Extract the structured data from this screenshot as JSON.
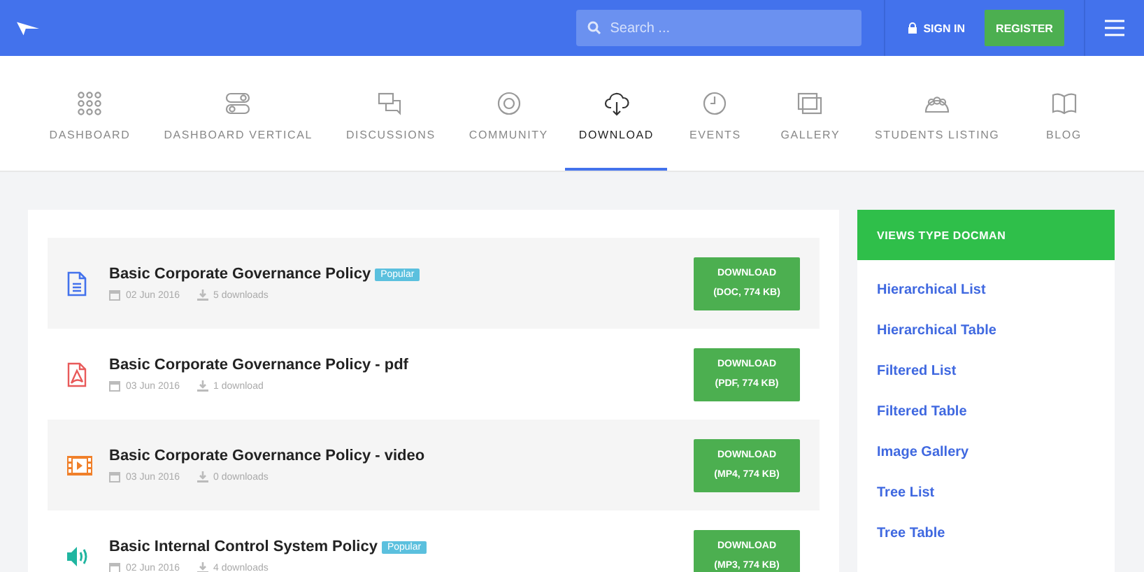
{
  "header": {
    "search": {
      "placeholder": "Search ..."
    },
    "sign_in": "SIGN IN",
    "register": "REGISTER"
  },
  "nav": [
    {
      "label": "DASHBOARD",
      "kind": "grid",
      "selected": false
    },
    {
      "label": "DASHBOARD VERTICAL",
      "kind": "toggles",
      "selected": false
    },
    {
      "label": "DISCUSSIONS",
      "kind": "chat",
      "selected": false
    },
    {
      "label": "COMMUNITY",
      "kind": "target",
      "selected": false
    },
    {
      "label": "DOWNLOAD",
      "kind": "cloud",
      "selected": true
    },
    {
      "label": "EVENTS",
      "kind": "clock",
      "selected": false
    },
    {
      "label": "GALLERY",
      "kind": "gallery",
      "selected": false
    },
    {
      "label": "STUDENTS LISTING",
      "kind": "people",
      "selected": false
    },
    {
      "label": "BLOG",
      "kind": "book",
      "selected": false
    }
  ],
  "documents": [
    {
      "title": "Basic Corporate Governance Policy",
      "kind": "doc",
      "badge": "Popular",
      "date": "02 Jun 2016",
      "downloads": "5 downloads",
      "button": "DOWNLOAD",
      "file": "(DOC, 774 KB)"
    },
    {
      "title": "Basic Corporate Governance Policy - pdf",
      "kind": "pdf",
      "date": "03 Jun 2016",
      "downloads": "1 download",
      "button": "DOWNLOAD",
      "file": "(PDF, 774 KB)"
    },
    {
      "title": "Basic Corporate Governance Policy - video",
      "kind": "video",
      "date": "03 Jun 2016",
      "downloads": "0 downloads",
      "button": "DOWNLOAD",
      "file": "(MP4, 774 KB)"
    },
    {
      "title": "Basic Internal Control System Policy",
      "kind": "audio",
      "badge": "Popular",
      "date": "02 Jun 2016",
      "downloads": "4 downloads",
      "button": "DOWNLOAD",
      "file": "(MP3, 774 KB)"
    }
  ],
  "sidebar": {
    "title": "VIEWS TYPE DOCMAN",
    "links": [
      "Hierarchical List",
      "Hierarchical Table",
      "Filtered List",
      "Filtered Table",
      "Image Gallery",
      "Tree List",
      "Tree Table"
    ]
  }
}
